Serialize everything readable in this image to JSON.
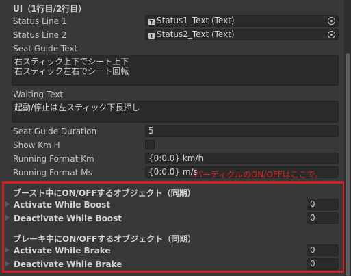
{
  "header": {
    "title": "UI（1行目/2行目）"
  },
  "fields": {
    "status_line_1": {
      "label": "Status Line 1",
      "value": "Status1_Text (Text)"
    },
    "status_line_2": {
      "label": "Status Line 2",
      "value": "Status2_Text (Text)"
    },
    "seat_guide_text": {
      "label": "Seat Guide Text",
      "value": "右スティック上下でシート上下\n右スティック左右でシート回転"
    },
    "waiting_text": {
      "label": "Waiting Text",
      "value": "起動/停止は左スティック下長押し"
    },
    "seat_guide_duration": {
      "label": "Seat Guide Duration",
      "value": "5"
    },
    "show_km_h": {
      "label": "Show Km H",
      "checked": false
    },
    "running_format_km": {
      "label": "Running Format Km",
      "value": "{0:0.0} km/h"
    },
    "running_format_ms": {
      "label": "Running Format Ms",
      "value": "{0:0.0} m/s"
    }
  },
  "annotation": {
    "text": "パーティクルのON/OFFはここで。",
    "color": "#e02020"
  },
  "boost_section": {
    "title": "ブースト中にON/OFFするオブジェクト（同期）",
    "activate": {
      "label": "Activate While Boost",
      "size": "0"
    },
    "deactivate": {
      "label": "Deactivate While Boost",
      "size": "0"
    }
  },
  "brake_section": {
    "title": "ブレーキ中にON/OFFするオブジェクト（同期）",
    "activate": {
      "label": "Activate While Brake",
      "size": "0"
    },
    "deactivate": {
      "label": "Deactivate While Brake",
      "size": "0"
    }
  },
  "colors": {
    "highlight_border": "#d42020",
    "background": "#383838",
    "field_bg": "#2a2a2a"
  },
  "icons": {
    "object_field": "text-component-icon",
    "picker": "object-picker-icon",
    "foldout": "foldout-arrow-icon"
  }
}
